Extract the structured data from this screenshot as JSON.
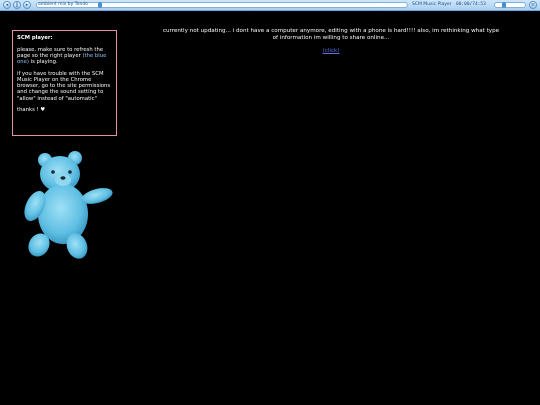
{
  "player": {
    "track_title": "ambient mix by Tondo",
    "name": "SCM Music Player",
    "timecode": "00:00/74:53"
  },
  "info_box": {
    "title": "SCM player:",
    "para1_before": "please, make sure to refresh the page so the right player ",
    "para1_link": "(the blue one)",
    "para1_after": " is playing.",
    "para2": "if you have trouble with the SCM Music Player on the Chrome browser, go to the site permissions and change the sound setting to \"allow\" instead of \"automatic\"",
    "thanks": "thanks ! ♥"
  },
  "notice": {
    "text": "currently not updating... i dont have a computer anymore, editing with a phone is hard!!!! also, im rethinking what type of information im willing to share online...",
    "link": "(click)"
  },
  "colors": {
    "background": "#000000",
    "box_border": "#e88fa8",
    "teddy": "#6fc8e8",
    "player_bar": "#bcdcf7"
  },
  "icons": [
    "prev-icon",
    "pause-icon",
    "next-icon",
    "playlist-icon",
    "menu-icon"
  ]
}
